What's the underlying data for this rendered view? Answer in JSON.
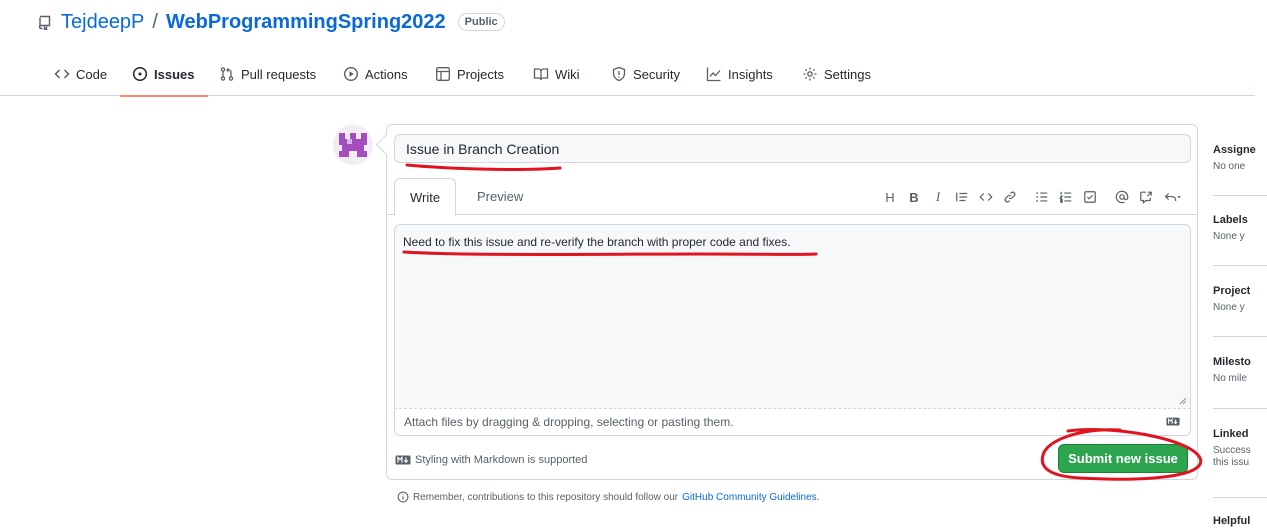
{
  "repo": {
    "owner": "TejdeepP",
    "separator": "/",
    "name": "WebProgrammingSpring2022",
    "visibility": "Public",
    "icon": "repo-icon"
  },
  "tabs": [
    {
      "label": "Code",
      "icon": "code-icon",
      "selected": false
    },
    {
      "label": "Issues",
      "icon": "issue-opened-icon",
      "selected": true
    },
    {
      "label": "Pull requests",
      "icon": "git-pull-request-icon",
      "selected": false
    },
    {
      "label": "Actions",
      "icon": "play-icon",
      "selected": false
    },
    {
      "label": "Projects",
      "icon": "table-icon",
      "selected": false
    },
    {
      "label": "Wiki",
      "icon": "book-icon",
      "selected": false
    },
    {
      "label": "Security",
      "icon": "shield-icon",
      "selected": false
    },
    {
      "label": "Insights",
      "icon": "graph-icon",
      "selected": false
    },
    {
      "label": "Settings",
      "icon": "gear-icon",
      "selected": false
    }
  ],
  "issue_form": {
    "title_value": "Issue in Branch Creation",
    "editor_tabs": {
      "write": "Write",
      "preview": "Preview"
    },
    "toolbar": {
      "heading": "H",
      "bold": "B",
      "italic": "I",
      "icons": [
        "quote-icon",
        "code-icon",
        "link-icon",
        "unordered-list-icon",
        "ordered-list-icon",
        "tasklist-icon",
        "mention-icon",
        "cross-reference-icon",
        "reply-icon"
      ]
    },
    "body_value": "Need to fix this issue and re-verify the branch with proper code and fixes.",
    "attach_hint": "Attach files by dragging & dropping, selecting or pasting them.",
    "markdown_note": "Styling with Markdown is supported",
    "submit_label": "Submit new issue",
    "reminder_prefix": "Remember, contributions to this repository should follow our",
    "reminder_link": "GitHub Community Guidelines",
    "reminder_suffix": "."
  },
  "sidebar": [
    {
      "heading": "Assigne",
      "lines": [
        "No one"
      ]
    },
    {
      "heading": "Labels",
      "lines": [
        "None y"
      ]
    },
    {
      "heading": "Project",
      "lines": [
        "None y"
      ]
    },
    {
      "heading": "Milesto",
      "lines": [
        "No mile"
      ]
    },
    {
      "heading": "Linked",
      "lines": [
        "Success",
        "this issu"
      ]
    },
    {
      "heading": "Helpful",
      "lines": []
    }
  ],
  "colors": {
    "link": "#0969da",
    "primary_button": "#2da44e",
    "selected_tab_underline": "#fd8c73",
    "annotation": "#e0141e"
  }
}
